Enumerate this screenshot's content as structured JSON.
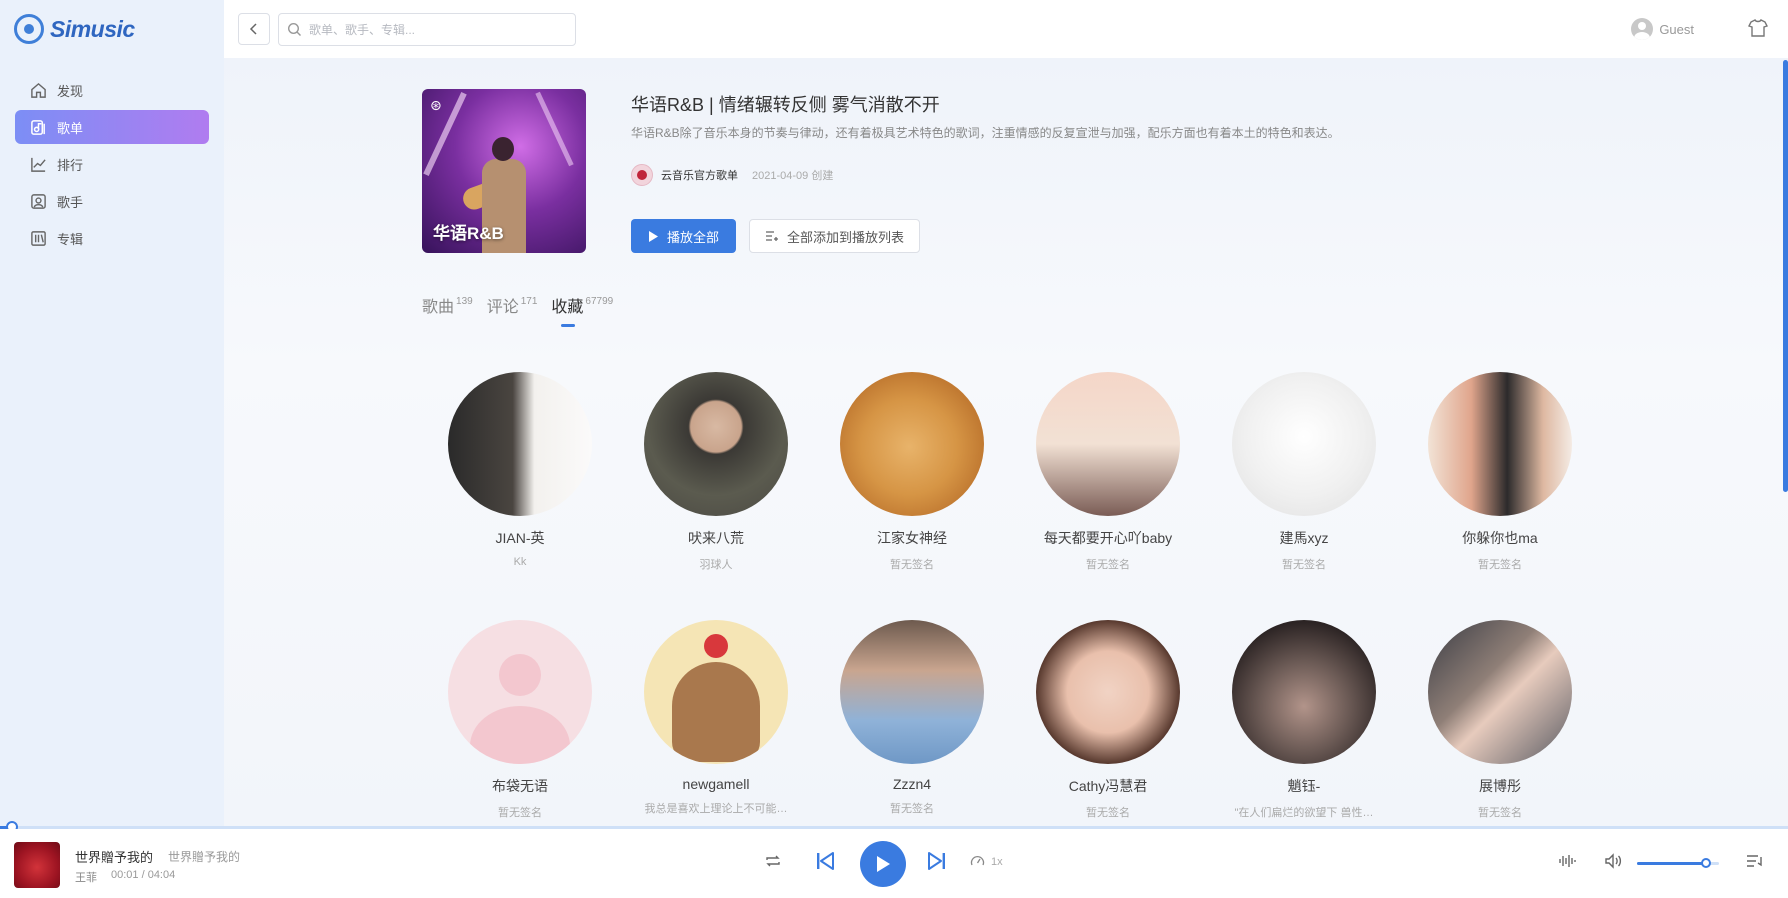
{
  "app": {
    "name": "Simusic"
  },
  "sidebar": {
    "items": [
      {
        "label": "发现",
        "icon": "home-icon",
        "active": false
      },
      {
        "label": "歌单",
        "icon": "playlist-icon",
        "active": true
      },
      {
        "label": "排行",
        "icon": "chart-line-icon",
        "active": false
      },
      {
        "label": "歌手",
        "icon": "singer-icon",
        "active": false
      },
      {
        "label": "专辑",
        "icon": "album-icon",
        "active": false
      }
    ]
  },
  "topbar": {
    "search_placeholder": "歌单、歌手、专辑...",
    "user_name": "Guest"
  },
  "playlist": {
    "cover_title": "华语R&B",
    "title": "华语R&B | 情绪辗转反侧 雾气消散不开",
    "description": "华语R&B除了音乐本身的节奏与律动，还有着极具艺术特色的歌词，注重情感的反复宣泄与加强，配乐方面也有着本土的特色和表达。",
    "creator": "云音乐官方歌单",
    "created": "2021-04-09 创建",
    "play_all_label": "播放全部",
    "add_all_label": "全部添加到播放列表"
  },
  "tabs": [
    {
      "label": "歌曲",
      "count": "139",
      "active": false
    },
    {
      "label": "评论",
      "count": "171",
      "active": false
    },
    {
      "label": "收藏",
      "count": "67799",
      "active": true
    }
  ],
  "subscribers": [
    {
      "name": "JIAN-英",
      "signature": "Kk"
    },
    {
      "name": "吠来八荒",
      "signature": "羽球人"
    },
    {
      "name": "江家女神经",
      "signature": "暂无签名"
    },
    {
      "name": "每天都要开心吖baby",
      "signature": "暂无签名"
    },
    {
      "name": "建馬xyz",
      "signature": "暂无签名"
    },
    {
      "name": "你躲你也ma",
      "signature": "暂无签名"
    },
    {
      "name": "布袋无语",
      "signature": "暂无签名"
    },
    {
      "name": "newgamell",
      "signature": "我总是喜欢上理论上不可能…"
    },
    {
      "name": "Zzzn4",
      "signature": "暂无签名"
    },
    {
      "name": "Cathy冯慧君",
      "signature": "暂无签名"
    },
    {
      "name": "魈钰-",
      "signature": "\"在人们扁烂的欲望下 兽性…"
    },
    {
      "name": "展博彤",
      "signature": "暂无签名"
    }
  ],
  "player": {
    "song_name": "世界贈予我的",
    "song_alias": "世界贈予我的",
    "artist": "王菲",
    "time": "00:01 / 04:04",
    "progress": 0.004,
    "speed": "1x",
    "volume": 0.84
  },
  "colors": {
    "accent": "#3a7be0",
    "active_nav_gradient_start": "#7c8ef5",
    "active_nav_gradient_end": "#b07cf0"
  }
}
